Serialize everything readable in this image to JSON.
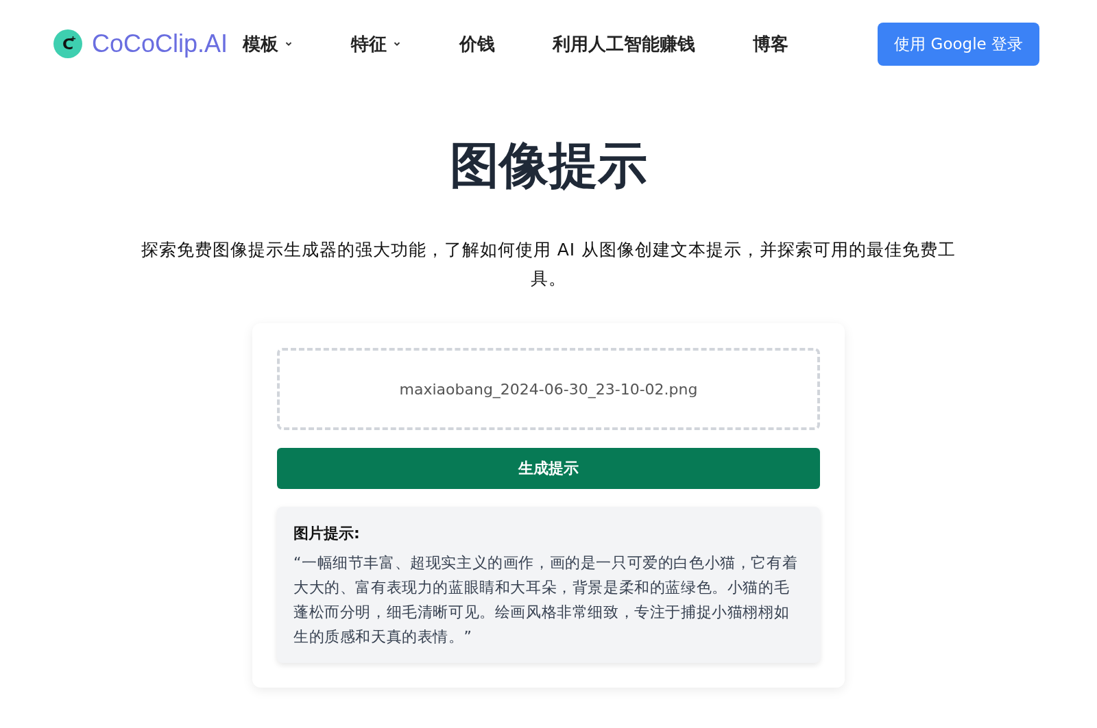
{
  "header": {
    "logo": {
      "mark": "C",
      "name": "CoCoClip.AI"
    },
    "nav": [
      {
        "label": "模板",
        "dropdown": true
      },
      {
        "label": "特征",
        "dropdown": true
      },
      {
        "label": "价钱",
        "dropdown": false
      },
      {
        "label": "利用人工智能赚钱",
        "dropdown": false
      },
      {
        "label": "博客",
        "dropdown": false
      }
    ],
    "login_button": "使用 Google 登录"
  },
  "title": "图像提示",
  "description": "探索免费图像提示生成器的强大功能，了解如何使用 AI 从图像创建文本提示，并探索可用的最佳免费工具。",
  "upload": {
    "file_name": "maxiaobang_2024-06-30_23-10-02.png"
  },
  "generate_button": "生成提示",
  "result": {
    "heading": "图片提示:",
    "text": "“一幅细节丰富、超现实主义的画作，画的是一只可爱的白色小猫，它有着大大的、富有表现力的蓝眼睛和大耳朵，背景是柔和的蓝绿色。小猫的毛蓬松而分明，细毛清晰可见。绘画风格非常细致，专注于捕捉小猫栩栩如生的质感和天真的表情。”"
  }
}
